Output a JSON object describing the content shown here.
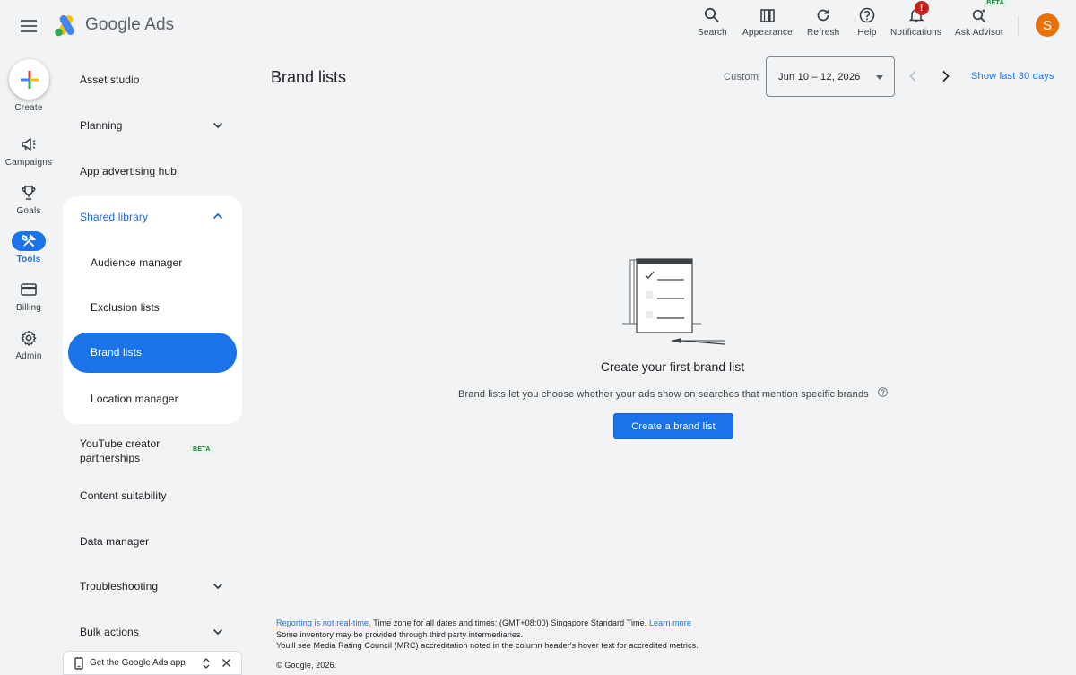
{
  "header": {
    "brand_google": "Google",
    "brand_ads": "Ads",
    "buttons": [
      {
        "label": "Search",
        "icon": "search-icon"
      },
      {
        "label": "Appearance",
        "icon": "appearance-icon"
      },
      {
        "label": "Refresh",
        "icon": "refresh-icon"
      },
      {
        "label": "Help",
        "icon": "help-icon"
      },
      {
        "label": "Notifications",
        "icon": "bell-icon",
        "badge": "!"
      },
      {
        "label": "Ask Advisor",
        "icon": "advisor-icon",
        "tag": "BETA"
      }
    ],
    "avatar_initial": "S"
  },
  "rail": {
    "create_label": "Create",
    "items": [
      {
        "label": "Campaigns",
        "icon": "megaphone-icon"
      },
      {
        "label": "Goals",
        "icon": "trophy-icon"
      },
      {
        "label": "Tools",
        "icon": "tools-icon",
        "active": true
      },
      {
        "label": "Billing",
        "icon": "credit-card-icon"
      },
      {
        "label": "Admin",
        "icon": "gear-icon"
      }
    ]
  },
  "nav": {
    "asset_studio": "Asset studio",
    "planning": "Planning",
    "app_hub": "App advertising hub",
    "shared_library": "Shared library",
    "audience_manager": "Audience manager",
    "exclusion_lists": "Exclusion lists",
    "brand_lists": "Brand lists",
    "location_manager": "Location manager",
    "youtube_line1": "YouTube creator",
    "youtube_line2": "partnerships",
    "youtube_beta": "BETA",
    "content_suitability": "Content suitability",
    "data_manager": "Data manager",
    "troubleshooting": "Troubleshooting",
    "bulk_actions": "Bulk actions",
    "app_promo": "Get the Google Ads app"
  },
  "main": {
    "title": "Brand lists",
    "date_label": "Custom",
    "date_value": "Jun 10 – 12, 2026",
    "show_last": "Show last 30 days",
    "empty_title": "Create your first brand list",
    "empty_desc": "Brand lists let you choose whether your ads show on searches that mention specific brands",
    "create_button": "Create a brand list"
  },
  "footer": {
    "realtime_link": "Reporting is not real-time.",
    "timezone_text": " Time zone for all dates and times: (GMT+08:00) Singapore Standard Time. ",
    "learn_more": "Learn more",
    "line2": "Some inventory may be provided through third party intermediaries.",
    "line3": "You'll see Media Rating Council (MRC) accreditation noted in the column header's hover text for accredited metrics.",
    "copyright": "© Google, 2026."
  },
  "colors": {
    "accent": "#1a73e8",
    "background": "#f1f3f4",
    "avatar": "#e8710a",
    "badge": "#c5221f"
  }
}
